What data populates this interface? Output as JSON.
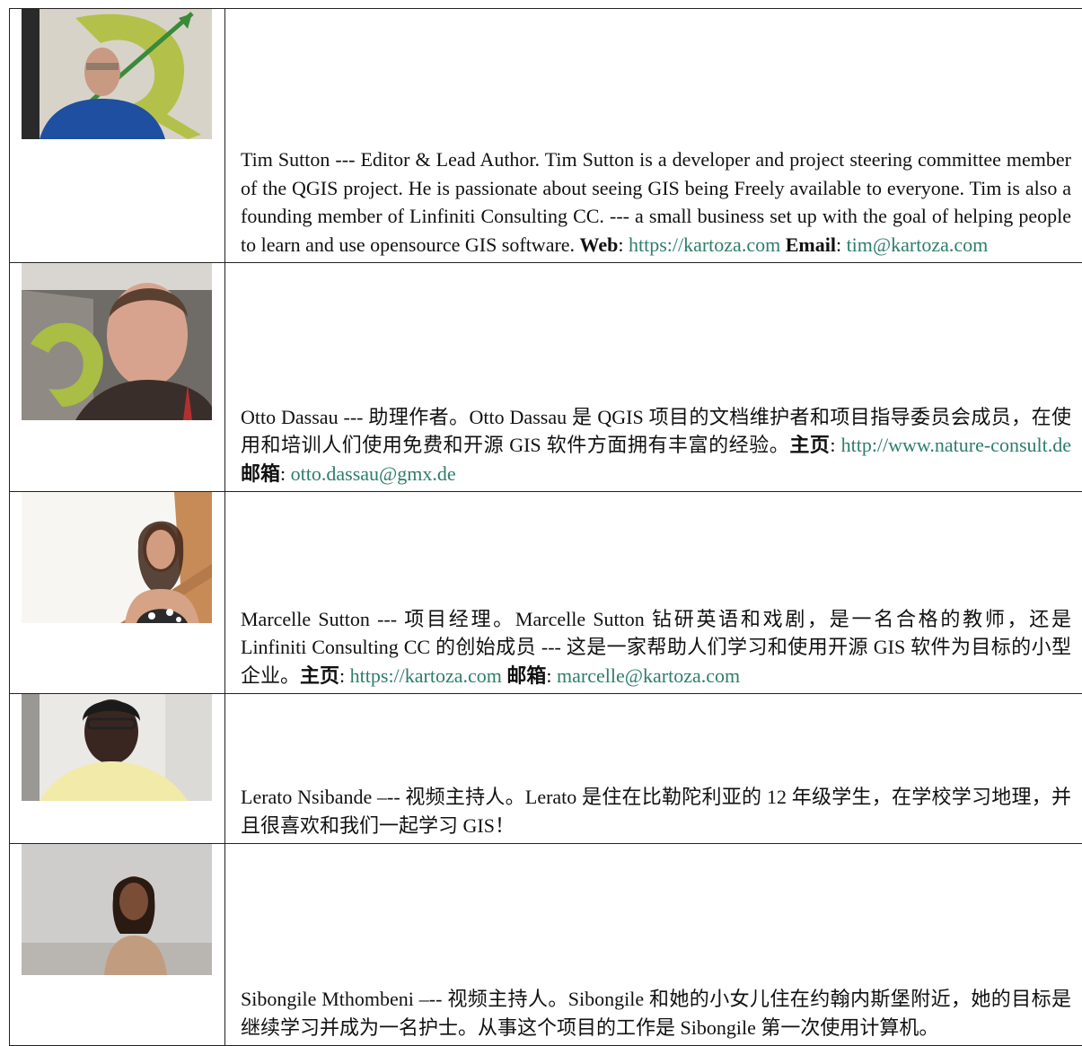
{
  "authors": [
    {
      "photo_icon": "portrait-photo-tim-sutton",
      "name": "Tim Sutton",
      "sep": " --- ",
      "role": "Editor & Lead Author.",
      "bio": "  Tim Sutton is a developer and project steering committee member of the QGIS project. He is passionate about seeing GIS being Freely available to everyone.  Tim is also a founding member of Linfiniti Consulting CC. --- a small business set up with the goal of helping people to learn and use opensource GIS software. ",
      "web_label": "Web",
      "web_url": "https://kartoza.com",
      "email_label": "Email",
      "email": "tim@kartoza.com"
    },
    {
      "photo_icon": "portrait-photo-otto-dassau",
      "name": "Otto Dassau",
      "sep": " --- ",
      "role": "助理作者。",
      "bio": "Otto Dassau 是 QGIS 项目的文档维护者和项目指导委员会成员，在使用和培训人们使用免费和开源 GIS 软件方面拥有丰富的经验。",
      "web_label": "主页",
      "web_url": "http://www.nature-consult.de",
      "email_label": "邮箱",
      "email": "otto.dassau@gmx.de"
    },
    {
      "photo_icon": "portrait-photo-marcelle-sutton",
      "name": "Marcelle Sutton",
      "sep": " --- ",
      "role": "项目经理。",
      "bio": "Marcelle Sutton 钻研英语和戏剧，是一名合格的教师，还是 Linfiniti Consulting CC 的创始成员 --- 这是一家帮助人们学习和使用开源 GIS 软件为目标的小型企业。",
      "web_label": "主页",
      "web_url": "https://kartoza.com",
      "email_label": "邮箱",
      "email": "marcelle@kartoza.com"
    },
    {
      "photo_icon": "portrait-photo-lerato-nsibande",
      "name": "Lerato Nsibande",
      "sep": " –-- ",
      "role": "视频主持人。",
      "bio": "Lerato 是住在比勒陀利亚的 12 年级学生，在学校学习地理，并且很喜欢和我们一起学习 GIS！"
    },
    {
      "photo_icon": "portrait-photo-sibongile-mthombeni",
      "name": "Sibongile Mthombeni",
      "sep": " –-- ",
      "role": "视频主持人。",
      "bio": "Sibongile 和她的小女儿住在约翰内斯堡附近，她的目标是继续学习并成为一名护士。从事这个项目的工作是 Sibongile 第一次使用计算机。"
    }
  ]
}
